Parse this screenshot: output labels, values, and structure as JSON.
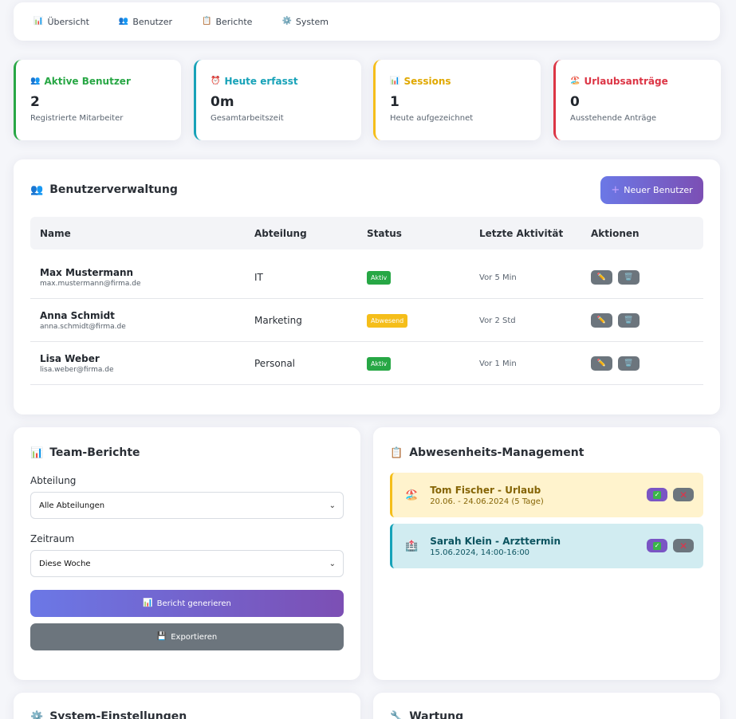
{
  "nav": [
    {
      "label": "Übersicht",
      "icon": "bar-chart-icon",
      "glyph": "📊"
    },
    {
      "label": "Benutzer",
      "icon": "users-icon",
      "glyph": "👥"
    },
    {
      "label": "Berichte",
      "icon": "clipboard-icon",
      "glyph": "📋"
    },
    {
      "label": "System",
      "icon": "gear-icon",
      "glyph": "⚙️"
    }
  ],
  "stats": [
    {
      "title": "Aktive Benutzer",
      "value": "2",
      "desc": "Registrierte Mitarbeiter",
      "icon": "users-icon",
      "glyph": "👥",
      "color": "#28a745"
    },
    {
      "title": "Heute erfasst",
      "value": "0m",
      "desc": "Gesamtarbeitszeit",
      "icon": "alarm-clock-icon",
      "glyph": "⏰",
      "color": "#17a2b8"
    },
    {
      "title": "Sessions",
      "value": "1",
      "desc": "Heute aufgezeichnet",
      "icon": "bar-chart-icon",
      "glyph": "📊",
      "color": "#f5be1a"
    },
    {
      "title": "Urlaubsanträge",
      "value": "0",
      "desc": "Ausstehende Anträge",
      "icon": "beach-icon",
      "glyph": "🏖️",
      "color": "#dc3545"
    }
  ],
  "users": {
    "title": "Benutzerverwaltung",
    "new_button": "Neuer Benutzer",
    "columns": [
      "Name",
      "Abteilung",
      "Status",
      "Letzte Aktivität",
      "Aktionen"
    ],
    "rows": [
      {
        "name": "Max Mustermann",
        "email": "max.mustermann@firma.de",
        "dept": "IT",
        "status": "Aktiv",
        "status_type": "active",
        "last": "Vor 5 Min"
      },
      {
        "name": "Anna Schmidt",
        "email": "anna.schmidt@firma.de",
        "dept": "Marketing",
        "status": "Abwesend",
        "status_type": "away",
        "last": "Vor 2 Std"
      },
      {
        "name": "Lisa Weber",
        "email": "lisa.weber@firma.de",
        "dept": "Personal",
        "status": "Aktiv",
        "status_type": "active",
        "last": "Vor 1 Min"
      }
    ]
  },
  "reports": {
    "title": "Team-Berichte",
    "dept_label": "Abteilung",
    "dept_value": "Alle Abteilungen",
    "period_label": "Zeitraum",
    "period_value": "Diese Woche",
    "generate_button": "Bericht generieren",
    "export_button": "Exportieren"
  },
  "absence": {
    "title": "Abwesenheits-Management",
    "items": [
      {
        "title": "Tom Fischer - Urlaub",
        "sub": "20.06. - 24.06.2024 (5 Tage)",
        "icon": "beach-icon",
        "glyph": "🏖️",
        "bg": "#fff3cd",
        "border": "#f5be1a",
        "text": "#856404"
      },
      {
        "title": "Sarah Klein - Arzttermin",
        "sub": "15.06.2024, 14:00-16:00",
        "icon": "hospital-icon",
        "glyph": "🏥",
        "bg": "#d1ecf1",
        "border": "#17a2b8",
        "text": "#0c5460"
      }
    ]
  },
  "system": {
    "title": "System-Einstellungen"
  },
  "maintenance": {
    "title": "Wartung"
  }
}
